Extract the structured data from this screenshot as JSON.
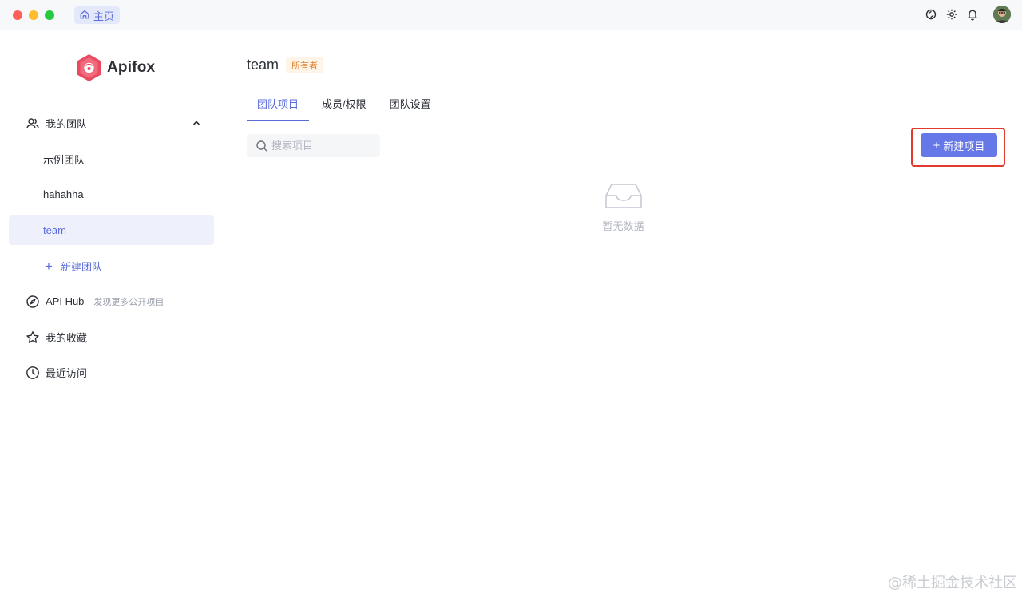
{
  "titlebar": {
    "home_tab_label": "主页"
  },
  "brand": {
    "name": "Apifox",
    "accent_color": "#e84a5f"
  },
  "sidebar": {
    "my_teams_label": "我的团队",
    "teams": [
      {
        "label": "示例团队"
      },
      {
        "label": "hahahha"
      },
      {
        "label": "team"
      }
    ],
    "new_team_label": "新建团队",
    "api_hub_label": "API Hub",
    "api_hub_note": "发现更多公开项目",
    "favorites_label": "我的收藏",
    "recent_label": "最近访问"
  },
  "main": {
    "team_name": "team",
    "owner_badge": "所有者",
    "tabs": [
      {
        "label": "团队项目"
      },
      {
        "label": "成员/权限"
      },
      {
        "label": "团队设置"
      }
    ],
    "search_placeholder": "搜索项目",
    "new_project_label": "新建项目",
    "empty_text": "暂无数据"
  },
  "colors": {
    "primary": "#5b6bd9",
    "button": "#6677e8",
    "highlight_border": "#e23b2e",
    "owner_badge": "#e0802e"
  },
  "watermark": "@稀土掘金技术社区"
}
